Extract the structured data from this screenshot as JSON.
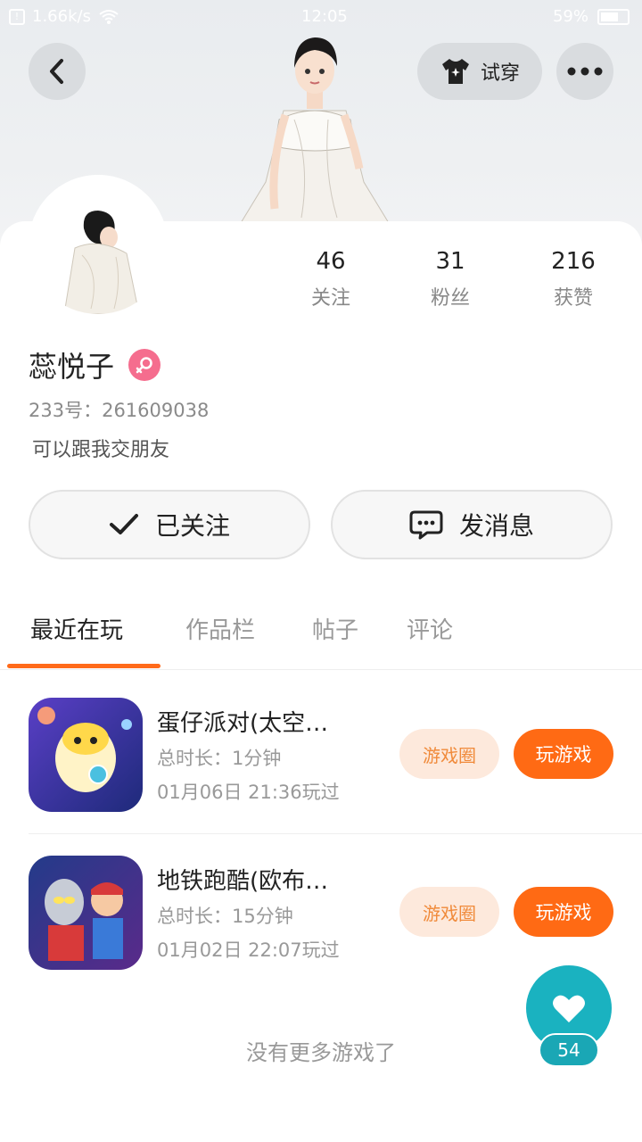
{
  "status_bar": {
    "net_speed": "1.66k/s",
    "time": "12:05",
    "battery": "59%",
    "battery_level": 0.59
  },
  "header": {
    "try_on_label": "试穿",
    "back_icon": "chevron-left-icon",
    "more_icon": "more-dots-icon",
    "try_on_icon": "tshirt-icon"
  },
  "profile": {
    "name": "蕊悦子",
    "gender_icon": "female-icon",
    "uid": "233号：261609038",
    "bio": "可以跟我交朋友"
  },
  "stats": [
    {
      "value": "46",
      "label": "关注"
    },
    {
      "value": "31",
      "label": "粉丝"
    },
    {
      "value": "216",
      "label": "获赞"
    }
  ],
  "actions": {
    "follow_label": "已关注",
    "message_label": "发消息"
  },
  "tabs": [
    {
      "label": "最近在玩",
      "active": true
    },
    {
      "label": "作品栏",
      "active": false
    },
    {
      "label": "帖子",
      "active": false
    },
    {
      "label": "评论",
      "active": false
    }
  ],
  "games": [
    {
      "title": "蛋仔派对(太空…",
      "duration": "总时长：1分钟",
      "played": "01月06日  21:36玩过",
      "circle_label": "游戏圈",
      "play_label": "玩游戏"
    },
    {
      "title": "地铁跑酷(欧布…",
      "duration": "总时长：15分钟",
      "played": "01月02日  22:07玩过",
      "circle_label": "游戏圈",
      "play_label": "玩游戏"
    }
  ],
  "footer": {
    "no_more": "没有更多游戏了",
    "like_count": "54"
  },
  "colors": {
    "accent_orange": "#ff6a14",
    "teal": "#1ab2c0",
    "female_pink": "#f56d8e"
  }
}
